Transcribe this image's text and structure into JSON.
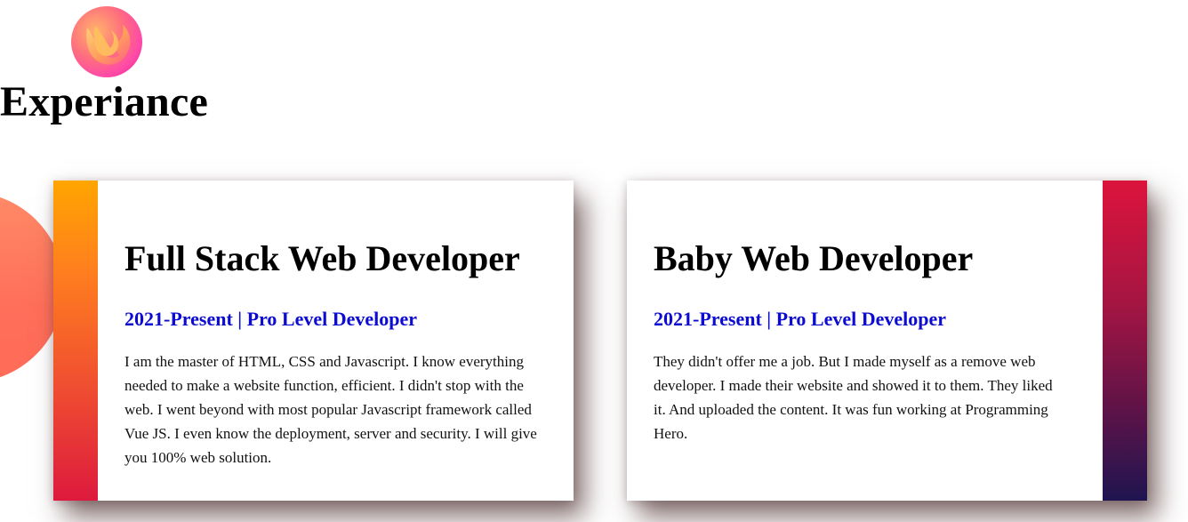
{
  "brand": {
    "logo_icon": "flame-logo-icon",
    "colors": {
      "logo_pink": "#e81693",
      "logo_orange": "#ffb36b",
      "accent_blue": "#0b0bd1",
      "decor_coral": "#ff6f5a"
    }
  },
  "section": {
    "title": "Experiance"
  },
  "cards": [
    {
      "title": "Full Stack Web Developer",
      "subtitle": "2021-Present | Pro Level Developer",
      "body": "I am the master of HTML, CSS and Javascript. I know everything needed to make a website function, efficient. I didn't stop with the web. I went beyond with most popular Javascript framework called Vue JS. I even know the deployment, server and security. I will give you 100% web solution.",
      "stripe_colors": [
        "#ffa500",
        "#dc143c"
      ]
    },
    {
      "title": "Baby Web Developer",
      "subtitle": "2021-Present | Pro Level Developer",
      "body": "They didn't offer me a job. But I made myself as a remove web developer. I made their website and showed it to them. They liked it. And uploaded the content. It was fun working at Programming Hero.",
      "stripe_colors": [
        "#dc143c",
        "#1f1450"
      ]
    }
  ]
}
